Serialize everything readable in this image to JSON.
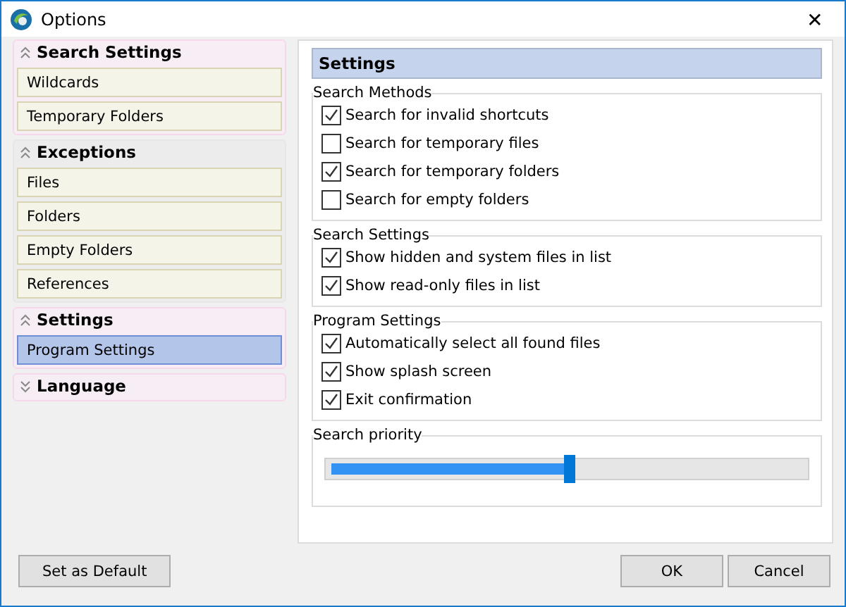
{
  "window": {
    "title": "Options",
    "close": "✕"
  },
  "sidebar": {
    "groups": [
      {
        "title": "Search Settings",
        "expanded": true,
        "items": [
          {
            "label": "Wildcards",
            "selected": false
          },
          {
            "label": "Temporary Folders",
            "selected": false
          }
        ]
      },
      {
        "title": "Exceptions",
        "expanded": true,
        "items": [
          {
            "label": "Files",
            "selected": false
          },
          {
            "label": "Folders",
            "selected": false
          },
          {
            "label": "Empty Folders",
            "selected": false
          },
          {
            "label": "References",
            "selected": false
          }
        ]
      },
      {
        "title": "Settings",
        "expanded": true,
        "items": [
          {
            "label": "Program Settings",
            "selected": true
          }
        ]
      },
      {
        "title": "Language",
        "expanded": false
      }
    ]
  },
  "panel": {
    "title": "Settings",
    "groups": [
      {
        "title": "Search Methods",
        "options": [
          {
            "label": "Search for invalid shortcuts",
            "checked": true
          },
          {
            "label": "Search for temporary files",
            "checked": false
          },
          {
            "label": "Search for temporary folders",
            "checked": true
          },
          {
            "label": "Search for empty folders",
            "checked": false
          }
        ]
      },
      {
        "title": "Search Settings",
        "options": [
          {
            "label": "Show hidden and system files in list",
            "checked": true
          },
          {
            "label": "Show read-only files in list",
            "checked": true
          }
        ]
      },
      {
        "title": "Program Settings",
        "options": [
          {
            "label": "Automatically select all found files",
            "checked": true
          },
          {
            "label": "Show splash screen",
            "checked": true
          },
          {
            "label": "Exit confirmation",
            "checked": true
          }
        ]
      }
    ],
    "priority": {
      "title": "Search priority",
      "level": 0.5
    }
  },
  "buttons": {
    "left": [
      "Set as Default"
    ],
    "right": [
      "OK",
      "Cancel"
    ]
  }
}
